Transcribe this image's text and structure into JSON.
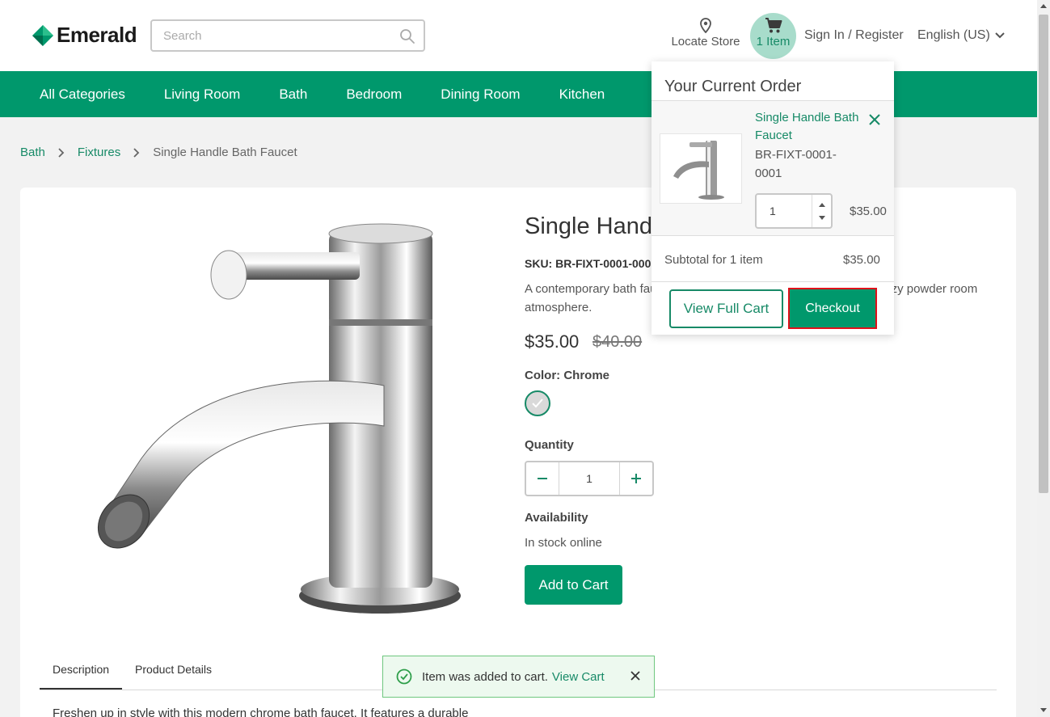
{
  "brand": {
    "name": "Emerald",
    "color": "#00986c"
  },
  "search": {
    "placeholder": "Search"
  },
  "header": {
    "locate_label": "Locate Store",
    "cart_label": "1 Item",
    "signin_label": "Sign In / Register",
    "language": "English (US)"
  },
  "nav": {
    "items": [
      "All Categories",
      "Living Room",
      "Bath",
      "Bedroom",
      "Dining Room",
      "Kitchen"
    ]
  },
  "breadcrumb": {
    "items": [
      "Bath",
      "Fixtures",
      "Single Handle Bath Faucet"
    ]
  },
  "product": {
    "title": "Single Handle Bath Faucet",
    "sku": "SKU: BR-FIXT-0001-0001",
    "description": "A contemporary bath faucet with a sleek chrome finish, creating a cozy powder room atmosphere.",
    "price": "$35.00",
    "old_price": "$40.00",
    "color_label": "Color: Chrome",
    "quantity_label": "Quantity",
    "quantity": "1",
    "availability_label": "Availability",
    "availability": "In stock online",
    "add_to_cart": "Add to Cart"
  },
  "tabs": {
    "items": [
      "Description",
      "Product Details"
    ],
    "active": "Description"
  },
  "long_description": "Freshen up in style with this modern chrome bath faucet. It features a durable",
  "toast": {
    "message": "Item was added to cart.",
    "link": "View Cart"
  },
  "cart_dropdown": {
    "title": "Your Current Order",
    "item_name": "Single Handle Bath Faucet",
    "item_sku": "BR-FIXT-0001-0001",
    "item_qty": "1",
    "item_price": "$35.00",
    "subtotal_label": "Subtotal for 1 item",
    "subtotal_value": "$35.00",
    "view_cart_label": "View Full Cart",
    "checkout_label": "Checkout"
  }
}
